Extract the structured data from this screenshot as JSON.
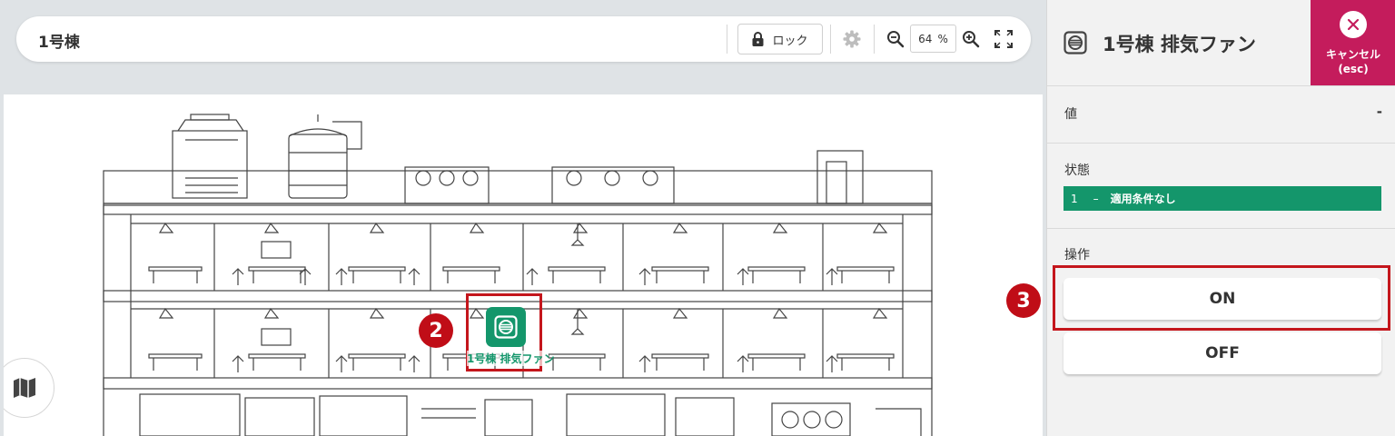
{
  "toolbar": {
    "title": "1号棟",
    "lock_label": "ロック",
    "zoom_value": "64",
    "zoom_unit": "%"
  },
  "device": {
    "label": "1号棟 排気ファン",
    "icon": "fan-icon"
  },
  "steps": {
    "marker": "2",
    "on_button": "3"
  },
  "panel": {
    "title": "1号棟 排気ファン",
    "cancel_label": "キャンセル",
    "cancel_hint": "(esc)",
    "value_label": "値",
    "value": "-",
    "state_label": "状態",
    "state": {
      "number": "1",
      "dash": "–",
      "text": "適用条件なし"
    },
    "operation_label": "操作",
    "buttons": {
      "on": "ON",
      "off": "OFF"
    }
  },
  "colors": {
    "accent_green": "#14966b",
    "cancel": "#c41c5c",
    "highlight_red": "#c4161c"
  },
  "icons": [
    "lock-icon",
    "gear-icon",
    "zoom-out-icon",
    "zoom-in-icon",
    "fullscreen-icon",
    "map-icon",
    "close-icon",
    "fan-icon"
  ]
}
